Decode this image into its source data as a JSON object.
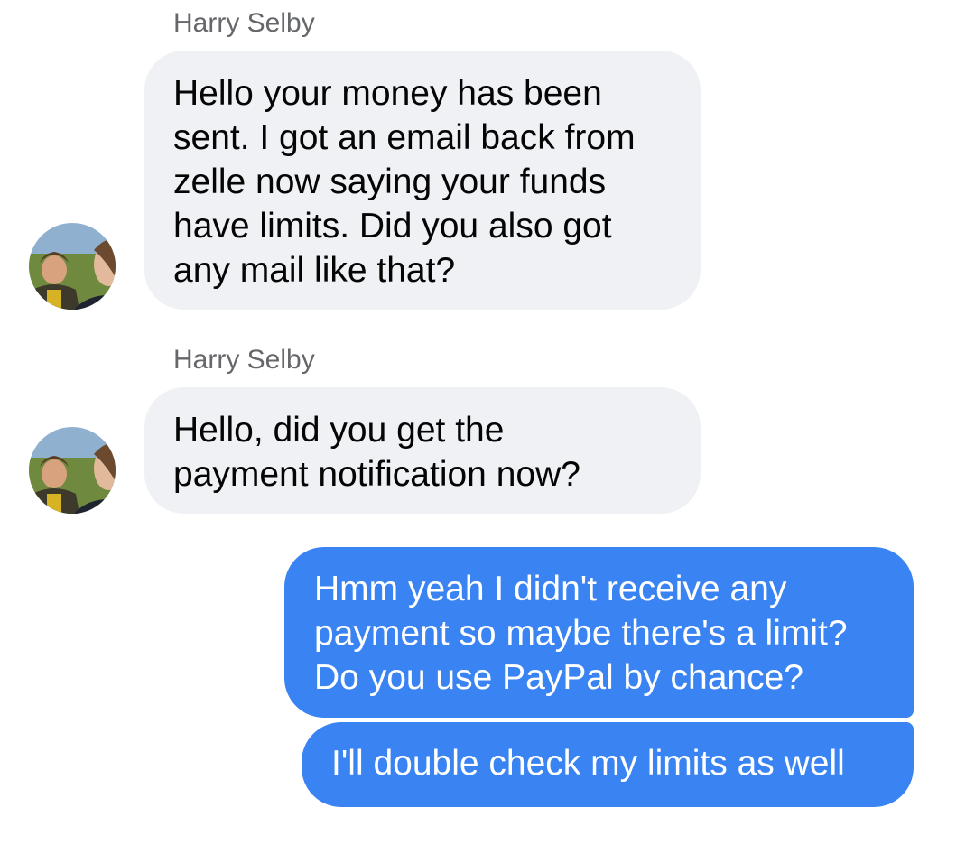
{
  "messages": [
    {
      "direction": "incoming",
      "sender": "Harry Selby",
      "text": "Hello your money has been\nsent. I got an email back from\nzelle now saying your funds\nhave limits. Did you also got\nany mail like that?"
    },
    {
      "direction": "incoming",
      "sender": "Harry Selby",
      "text": "Hello, did you get the\npayment notification now?"
    },
    {
      "direction": "outgoing",
      "text": "Hmm yeah I didn't receive any\npayment so maybe there's a limit?\nDo you use PayPal by chance?"
    },
    {
      "direction": "outgoing",
      "text": "I'll double check my limits as well"
    }
  ],
  "colors": {
    "incoming_bubble": "#f0f1f5",
    "outgoing_bubble": "#3a83f3",
    "sender_name": "#65676b"
  },
  "icons": {
    "avatar": "avatar-photo"
  }
}
